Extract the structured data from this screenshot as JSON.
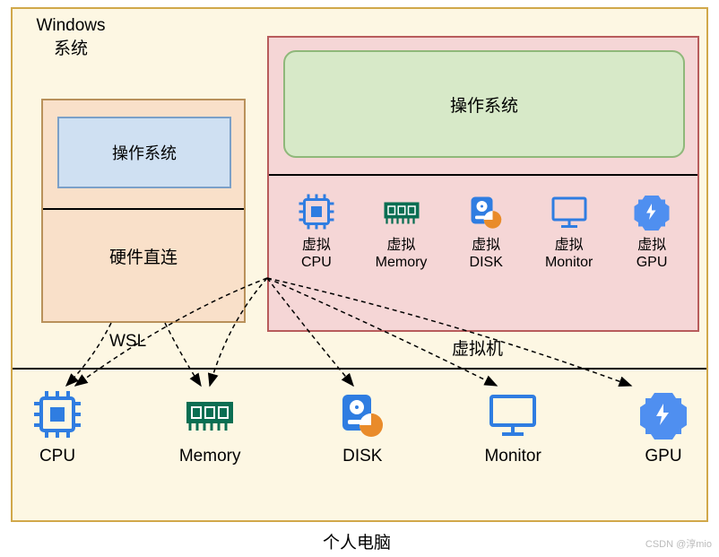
{
  "outer_title": "Windows\n系统",
  "wsl": {
    "os": "操作系统",
    "hw": "硬件直连",
    "label": "WSL"
  },
  "vm": {
    "os": "操作系统",
    "label": "虚拟机",
    "hw": [
      {
        "name": "虚拟\nCPU",
        "icon": "cpu"
      },
      {
        "name": "虚拟\nMemory",
        "icon": "memory"
      },
      {
        "name": "虚拟\nDISK",
        "icon": "disk"
      },
      {
        "name": "虚拟\nMonitor",
        "icon": "monitor"
      },
      {
        "name": "虚拟\nGPU",
        "icon": "gpu"
      }
    ]
  },
  "main_hw": [
    {
      "name": "CPU",
      "icon": "cpu"
    },
    {
      "name": "Memory",
      "icon": "memory"
    },
    {
      "name": "DISK",
      "icon": "disk"
    },
    {
      "name": "Monitor",
      "icon": "monitor"
    },
    {
      "name": "GPU",
      "icon": "gpu"
    }
  ],
  "pc_label": "个人电脑",
  "watermark": "CSDN @淳mio"
}
